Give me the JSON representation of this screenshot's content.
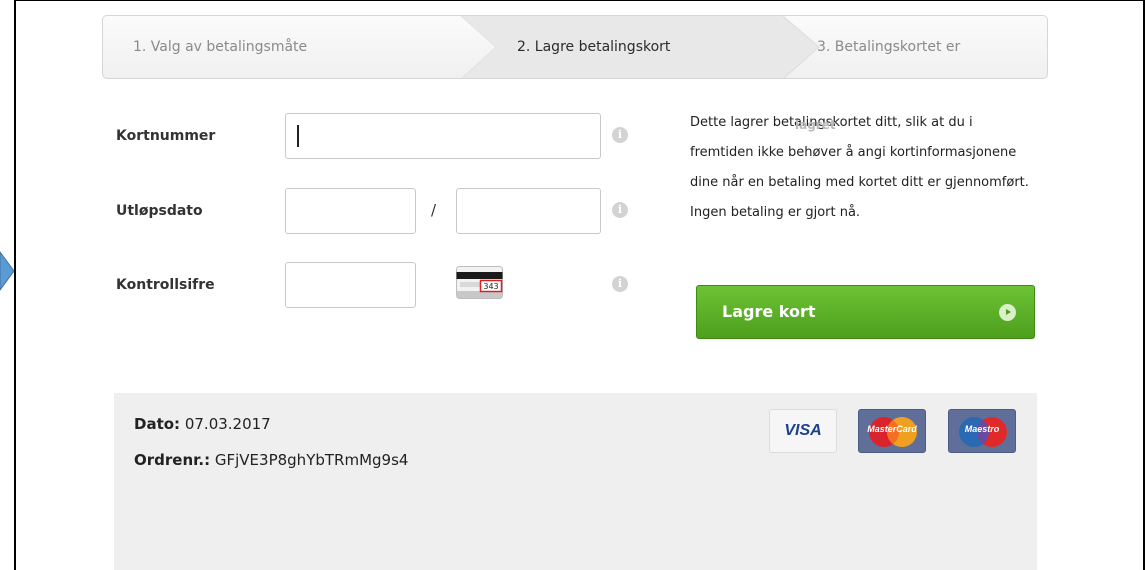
{
  "steps": [
    {
      "label": "1. Valg av betalingsmåte",
      "state": "done"
    },
    {
      "label": "2. Lagre betalingskort",
      "state": "active"
    },
    {
      "label": "3. Betalingskortet er",
      "state": "pending"
    }
  ],
  "ghost_text": "lagret",
  "form": {
    "card_number_label": "Kortnummer",
    "card_number_value": "",
    "expiry_label": "Utløpsdato",
    "expiry_separator": "/",
    "expiry_month_value": "",
    "expiry_year_value": "",
    "cvc_label": "Kontrollsifre",
    "cvc_value": "",
    "cvc_example": "343"
  },
  "description": "Dette lagrer betalingskortet ditt, slik at du i fremtiden ikke behøver å angi kortinformasjonene dine når en betaling med kortet ditt er gjennomført. Ingen betaling er gjort nå.",
  "save_button": {
    "label": "Lagre kort",
    "color": "#5cb226"
  },
  "order": {
    "date_label": "Dato:",
    "date_value": "07.03.2017",
    "order_label": "Ordrenr.:",
    "order_value": "GFjVE3P8ghYbTRmMg9s4"
  },
  "card_logos": [
    {
      "name": "VISA",
      "icon": "visa-logo"
    },
    {
      "name": "MasterCard",
      "icon": "mastercard-logo"
    },
    {
      "name": "Maestro",
      "icon": "maestro-logo"
    }
  ]
}
